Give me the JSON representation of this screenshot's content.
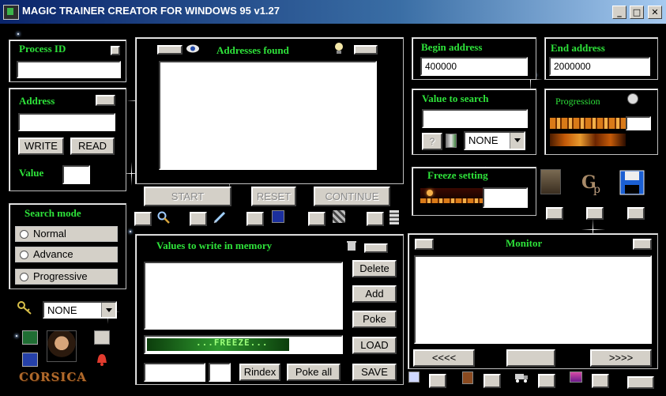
{
  "window": {
    "title": "MAGIC TRAINER CREATOR FOR WINDOWS 95  v1.27",
    "min_label": "_",
    "max_label": "□",
    "close_label": "✕"
  },
  "process": {
    "title": "Process ID",
    "value": ""
  },
  "address": {
    "title": "Address",
    "value": "",
    "write_label": "WRITE",
    "read_label": "READ",
    "value_title": "Value",
    "value_field": ""
  },
  "search_mode": {
    "title": "Search mode",
    "options": [
      "Normal",
      "Advance",
      "Progressive"
    ]
  },
  "type_select": {
    "value": "NONE"
  },
  "addresses": {
    "title": "Addresses found",
    "start_label": "START",
    "reset_label": "RESET",
    "continue_label": "CONTINUE"
  },
  "begin": {
    "title": "Begin address",
    "value": "400000"
  },
  "end": {
    "title": "End address",
    "value": "2000000"
  },
  "value_search": {
    "title": "Value to search",
    "value": "",
    "help_label": "?",
    "select_value": "NONE"
  },
  "progression": {
    "title": "Progression"
  },
  "freeze_setting": {
    "title": "Freeze setting"
  },
  "write_memory": {
    "title": "Values to write in memory",
    "delete_label": "Delete",
    "add_label": "Add",
    "poke_label": "Poke",
    "load_label": "LOAD",
    "save_label": "SAVE",
    "rindex_label": "Rindex",
    "pokeall_label": "Poke all",
    "freeze_text": "...FREEZE..."
  },
  "monitor": {
    "title": "Monitor",
    "prev_label": "<<<<",
    "next_label": ">>>>"
  },
  "logo": {
    "text": "CORSICA"
  },
  "colors": {
    "accent_green": "#2ee23a",
    "face": "#d4d0c8",
    "bg": "#000000"
  }
}
